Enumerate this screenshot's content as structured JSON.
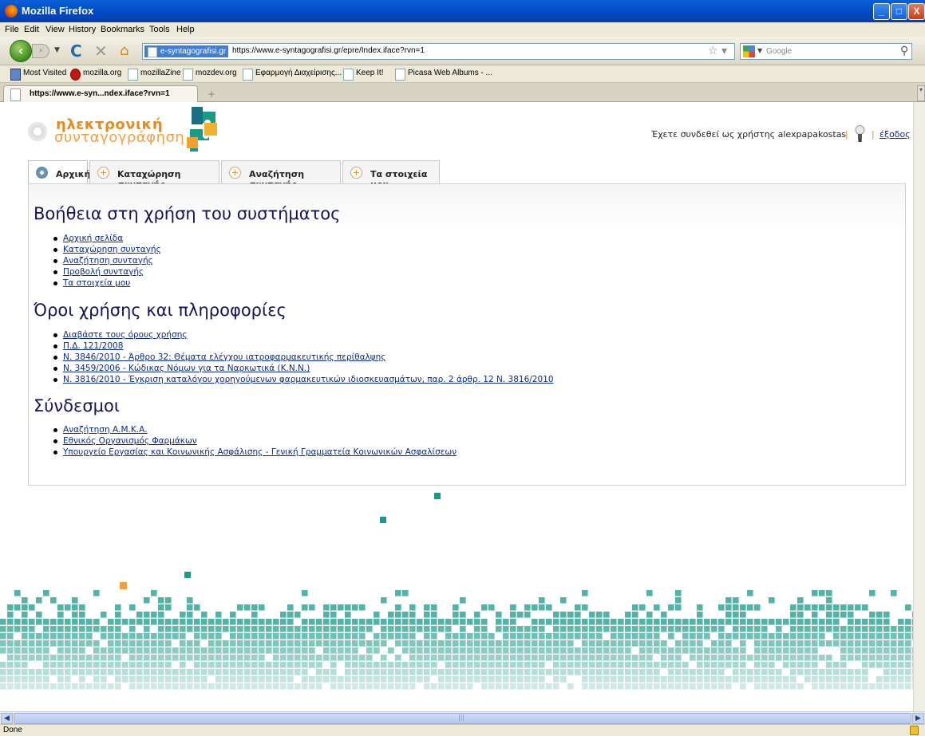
{
  "window": {
    "title": "Mozilla Firefox",
    "controls": {
      "minimize": "_",
      "maximize": "□",
      "close": "X"
    }
  },
  "menu": [
    "File",
    "Edit",
    "View",
    "History",
    "Bookmarks",
    "Tools",
    "Help"
  ],
  "navigation": {
    "back_glyph": "‹",
    "forward_glyph": "›",
    "site_identity": "e-syntagografisi.gr",
    "url": "https://www.e-syntagografisi.gr/epre/Index.iface?rvn=1",
    "search_placeholder": "Google"
  },
  "bookmarks": [
    "Most Visited",
    "mozilla.org",
    "mozillaZine",
    "mozdev.org",
    "Εφαρμογή Διαχείρισης...",
    "Keep It!",
    "Picasa Web Albums - ..."
  ],
  "browser_tab": {
    "title": "https://www.e-syn...ndex.iface?rvn=1",
    "new_tab": "+"
  },
  "site": {
    "logo_line1": "ηλεκτρονική",
    "logo_line2": "συνταγογράφηση",
    "logged_in_text": "Έχετε συνδεθεί ως χρήστης alexpapakostas",
    "separator": "|",
    "logout": "έξοδος"
  },
  "tabs": [
    {
      "label": "Αρχική",
      "active": true
    },
    {
      "label": "Καταχώρηση συνταγής",
      "active": false
    },
    {
      "label": "Αναζήτηση συνταγής",
      "active": false
    },
    {
      "label": "Τα στοιχεία μου",
      "active": false
    }
  ],
  "sections": [
    {
      "title": "Βοήθεια στη χρήση του συστήματος",
      "links": [
        "Αρχική σελίδα",
        "Καταχώρηση συνταγής",
        "Αναζήτηση συνταγής",
        "Προβολή συνταγής",
        "Τα στοιχεία μου"
      ]
    },
    {
      "title": "Όροι χρήσης και πληροφορίες",
      "links": [
        "Διαβάστε τους όρους χρήσης",
        "Π.Δ. 121/2008",
        "Ν. 3846/2010 - Άρθρο 32: Θέματα ελέγχου ιατροφαρμακευτικής περίθαλψης",
        "Ν. 3459/2006 - Κώδικας Νόμων για τα Ναρκωτικά (Κ.Ν.Ν.)",
        "Ν. 3816/2010 - Έγκριση καταλόγου χορηγούμενων φαρμακευτικών ιδιοσκευασμάτων, παρ. 2 άρθρ. 12 Ν. 3816/2010"
      ]
    },
    {
      "title": "Σύνδεσμοι",
      "links": [
        "Αναζήτηση Α.Μ.Κ.Α.",
        "Εθνικός Οργανισμός Φαρμάκων",
        "Υπουργείο Εργασίας και Κοινωνικής Ασφάλισης - Γενική Γραμματεία Κοινωνικών Ασφαλίσεων"
      ]
    }
  ],
  "status": {
    "text": "Done"
  },
  "colors": {
    "teal": "#1a9a8a",
    "orange": "#f0a040",
    "heading": "#14145a",
    "link": "#0a2a8a"
  }
}
